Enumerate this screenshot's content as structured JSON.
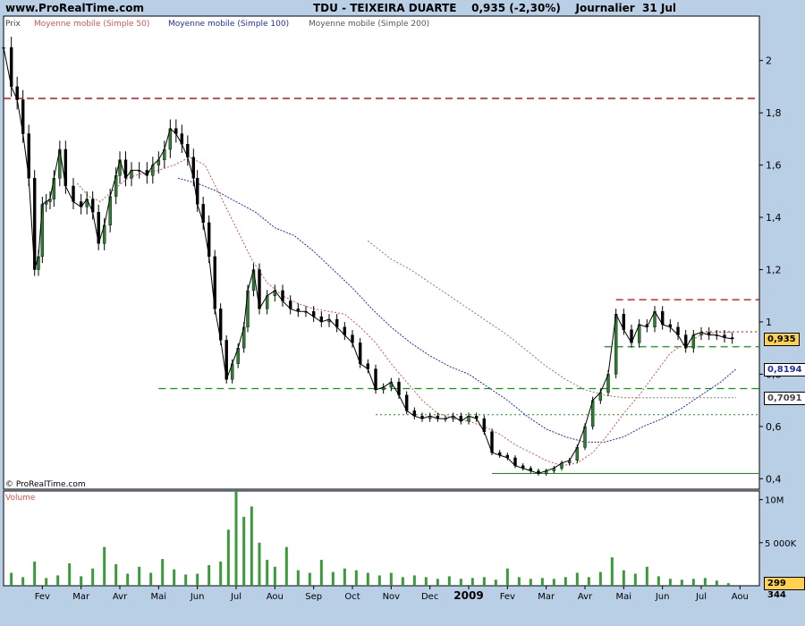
{
  "header": {
    "site": "www.ProRealTime.com",
    "title": "TDU - TEIXEIRA DUARTE    0,935 (-2,30%)    Journalier  31 Jul"
  },
  "legend": {
    "prix": "Prix",
    "ma50": "Moyenne mobile (Simple 50)",
    "ma100": "Moyenne mobile (Simple 100)",
    "ma200": "Moyenne mobile (Simple 200)",
    "copyright": "© ProRealTime.com",
    "volume": "Volume"
  },
  "colors": {
    "ma50": "#d9534f",
    "ma100": "#1f2fb8",
    "ma200": "#8c7a78",
    "candle_up": "#2e7d32",
    "candle_down": "#000000",
    "volume": "#3a9a3a",
    "hline_red": "#cc0000",
    "hline_green": "#119911"
  },
  "chart_data": {
    "type": "line",
    "price_axis": {
      "ticks": [
        "2",
        "1,8",
        "1,6",
        "1,4",
        "1,2",
        "1",
        "0,8",
        "0,6",
        "0,4"
      ],
      "ylim": [
        0.36,
        2.17
      ]
    },
    "volume_axis": {
      "ticks": [
        "10M",
        "5 000K"
      ],
      "ylim": [
        0,
        11000000
      ]
    },
    "x_labels": [
      "Fev",
      "Mar",
      "Avr",
      "Mai",
      "Jun",
      "Jul",
      "Aou",
      "Sep",
      "Oct",
      "Nov",
      "Dec",
      "2009",
      "Fev",
      "Mar",
      "Avr",
      "Mai",
      "Jun",
      "Jul",
      "Aou"
    ],
    "x_range_months": [
      0,
      19.5
    ],
    "x_label_months": [
      1,
      2,
      3,
      4,
      5,
      6,
      7,
      8,
      9,
      10,
      11,
      12,
      13,
      14,
      15,
      16,
      17,
      18,
      19
    ],
    "close": [
      [
        0.0,
        2.05
      ],
      [
        0.2,
        1.9
      ],
      [
        0.35,
        1.85
      ],
      [
        0.5,
        1.72
      ],
      [
        0.65,
        1.55
      ],
      [
        0.8,
        1.2
      ],
      [
        0.9,
        1.25
      ],
      [
        1.0,
        1.45
      ],
      [
        1.1,
        1.46
      ],
      [
        1.2,
        1.47
      ],
      [
        1.3,
        1.55
      ],
      [
        1.45,
        1.66
      ],
      [
        1.6,
        1.52
      ],
      [
        1.8,
        1.46
      ],
      [
        2.0,
        1.44
      ],
      [
        2.15,
        1.47
      ],
      [
        2.3,
        1.42
      ],
      [
        2.45,
        1.3
      ],
      [
        2.6,
        1.37
      ],
      [
        2.75,
        1.48
      ],
      [
        2.9,
        1.56
      ],
      [
        3.0,
        1.62
      ],
      [
        3.15,
        1.55
      ],
      [
        3.3,
        1.58
      ],
      [
        3.5,
        1.58
      ],
      [
        3.7,
        1.56
      ],
      [
        3.85,
        1.6
      ],
      [
        4.0,
        1.62
      ],
      [
        4.15,
        1.66
      ],
      [
        4.3,
        1.74
      ],
      [
        4.45,
        1.72
      ],
      [
        4.6,
        1.68
      ],
      [
        4.75,
        1.63
      ],
      [
        4.9,
        1.55
      ],
      [
        5.0,
        1.45
      ],
      [
        5.15,
        1.38
      ],
      [
        5.3,
        1.25
      ],
      [
        5.45,
        1.05
      ],
      [
        5.6,
        0.93
      ],
      [
        5.75,
        0.78
      ],
      [
        5.9,
        0.84
      ],
      [
        6.05,
        0.9
      ],
      [
        6.2,
        0.98
      ],
      [
        6.3,
        1.12
      ],
      [
        6.45,
        1.2
      ],
      [
        6.6,
        1.05
      ],
      [
        6.8,
        1.1
      ],
      [
        7.0,
        1.12
      ],
      [
        7.2,
        1.08
      ],
      [
        7.4,
        1.05
      ],
      [
        7.6,
        1.04
      ],
      [
        7.8,
        1.04
      ],
      [
        8.0,
        1.02
      ],
      [
        8.2,
        1.0
      ],
      [
        8.4,
        1.01
      ],
      [
        8.6,
        0.98
      ],
      [
        8.8,
        0.95
      ],
      [
        9.0,
        0.92
      ],
      [
        9.2,
        0.84
      ],
      [
        9.4,
        0.82
      ],
      [
        9.6,
        0.74
      ],
      [
        9.8,
        0.75
      ],
      [
        10.0,
        0.77
      ],
      [
        10.2,
        0.72
      ],
      [
        10.4,
        0.66
      ],
      [
        10.6,
        0.64
      ],
      [
        10.8,
        0.63
      ],
      [
        11.0,
        0.64
      ],
      [
        11.2,
        0.63
      ],
      [
        11.4,
        0.63
      ],
      [
        11.6,
        0.64
      ],
      [
        11.8,
        0.62
      ],
      [
        12.0,
        0.64
      ],
      [
        12.2,
        0.63
      ],
      [
        12.4,
        0.58
      ],
      [
        12.6,
        0.5
      ],
      [
        12.8,
        0.49
      ],
      [
        13.0,
        0.48
      ],
      [
        13.2,
        0.45
      ],
      [
        13.4,
        0.44
      ],
      [
        13.6,
        0.43
      ],
      [
        13.8,
        0.42
      ],
      [
        14.0,
        0.43
      ],
      [
        14.2,
        0.44
      ],
      [
        14.4,
        0.46
      ],
      [
        14.6,
        0.47
      ],
      [
        14.8,
        0.52
      ],
      [
        15.0,
        0.6
      ],
      [
        15.2,
        0.7
      ],
      [
        15.4,
        0.73
      ],
      [
        15.6,
        0.8
      ],
      [
        15.8,
        1.03
      ],
      [
        16.0,
        0.97
      ],
      [
        16.2,
        0.92
      ],
      [
        16.4,
        0.99
      ],
      [
        16.6,
        0.98
      ],
      [
        16.8,
        1.04
      ],
      [
        17.0,
        0.99
      ],
      [
        17.2,
        0.98
      ],
      [
        17.4,
        0.95
      ],
      [
        17.6,
        0.9
      ],
      [
        17.8,
        0.95
      ],
      [
        18.0,
        0.96
      ],
      [
        18.2,
        0.95
      ],
      [
        18.4,
        0.95
      ],
      [
        18.6,
        0.94
      ],
      [
        18.8,
        0.935
      ]
    ],
    "ma50": [
      [
        1.9,
        1.53
      ],
      [
        2.2,
        1.48
      ],
      [
        2.5,
        1.46
      ],
      [
        2.8,
        1.5
      ],
      [
        3.2,
        1.55
      ],
      [
        3.6,
        1.57
      ],
      [
        4.0,
        1.58
      ],
      [
        4.4,
        1.6
      ],
      [
        4.8,
        1.63
      ],
      [
        5.2,
        1.6
      ],
      [
        5.6,
        1.48
      ],
      [
        6.0,
        1.36
      ],
      [
        6.4,
        1.24
      ],
      [
        6.8,
        1.15
      ],
      [
        7.2,
        1.1
      ],
      [
        7.6,
        1.07
      ],
      [
        8.0,
        1.05
      ],
      [
        8.4,
        1.04
      ],
      [
        8.8,
        1.03
      ],
      [
        9.2,
        0.98
      ],
      [
        9.6,
        0.92
      ],
      [
        10.0,
        0.84
      ],
      [
        10.4,
        0.77
      ],
      [
        10.8,
        0.7
      ],
      [
        11.2,
        0.65
      ],
      [
        11.6,
        0.63
      ],
      [
        12.0,
        0.62
      ],
      [
        12.4,
        0.6
      ],
      [
        12.8,
        0.57
      ],
      [
        13.2,
        0.53
      ],
      [
        13.6,
        0.5
      ],
      [
        14.0,
        0.47
      ],
      [
        14.4,
        0.45
      ],
      [
        14.8,
        0.46
      ],
      [
        15.2,
        0.5
      ],
      [
        15.6,
        0.57
      ],
      [
        16.0,
        0.65
      ],
      [
        16.4,
        0.72
      ],
      [
        16.8,
        0.8
      ],
      [
        17.2,
        0.88
      ],
      [
        17.6,
        0.92
      ],
      [
        18.0,
        0.95
      ],
      [
        18.4,
        0.96
      ],
      [
        18.8,
        0.96
      ]
    ],
    "ma100": [
      [
        4.5,
        1.55
      ],
      [
        5.0,
        1.53
      ],
      [
        5.5,
        1.5
      ],
      [
        6.0,
        1.46
      ],
      [
        6.5,
        1.42
      ],
      [
        7.0,
        1.36
      ],
      [
        7.5,
        1.33
      ],
      [
        8.0,
        1.27
      ],
      [
        8.5,
        1.2
      ],
      [
        9.0,
        1.13
      ],
      [
        9.5,
        1.05
      ],
      [
        10.0,
        0.98
      ],
      [
        10.5,
        0.92
      ],
      [
        11.0,
        0.87
      ],
      [
        11.5,
        0.83
      ],
      [
        12.0,
        0.8
      ],
      [
        12.5,
        0.75
      ],
      [
        13.0,
        0.7
      ],
      [
        13.5,
        0.64
      ],
      [
        14.0,
        0.59
      ],
      [
        14.5,
        0.56
      ],
      [
        15.0,
        0.54
      ],
      [
        15.5,
        0.54
      ],
      [
        16.0,
        0.56
      ],
      [
        16.5,
        0.6
      ],
      [
        17.0,
        0.63
      ],
      [
        17.5,
        0.67
      ],
      [
        18.0,
        0.72
      ],
      [
        18.5,
        0.77
      ],
      [
        18.9,
        0.82
      ]
    ],
    "ma200": [
      [
        9.4,
        1.31
      ],
      [
        10.0,
        1.24
      ],
      [
        10.5,
        1.2
      ],
      [
        11.0,
        1.15
      ],
      [
        11.5,
        1.1
      ],
      [
        12.0,
        1.05
      ],
      [
        12.5,
        1.0
      ],
      [
        13.0,
        0.95
      ],
      [
        13.5,
        0.89
      ],
      [
        14.0,
        0.83
      ],
      [
        14.5,
        0.78
      ],
      [
        15.0,
        0.74
      ],
      [
        15.5,
        0.72
      ],
      [
        16.0,
        0.71
      ],
      [
        16.5,
        0.71
      ],
      [
        17.0,
        0.71
      ],
      [
        17.5,
        0.71
      ],
      [
        18.0,
        0.71
      ],
      [
        18.9,
        0.71
      ]
    ],
    "volume": [
      [
        0.2,
        1.5
      ],
      [
        0.5,
        1.0
      ],
      [
        0.8,
        2.8
      ],
      [
        1.1,
        0.9
      ],
      [
        1.4,
        1.2
      ],
      [
        1.7,
        2.6
      ],
      [
        2.0,
        1.1
      ],
      [
        2.3,
        2.0
      ],
      [
        2.6,
        4.5
      ],
      [
        2.9,
        2.5
      ],
      [
        3.2,
        1.4
      ],
      [
        3.5,
        2.2
      ],
      [
        3.8,
        1.5
      ],
      [
        4.1,
        3.1
      ],
      [
        4.4,
        1.9
      ],
      [
        4.7,
        1.3
      ],
      [
        5.0,
        1.4
      ],
      [
        5.3,
        2.4
      ],
      [
        5.6,
        2.8
      ],
      [
        5.8,
        6.5
      ],
      [
        6.0,
        11.0
      ],
      [
        6.2,
        8.0
      ],
      [
        6.4,
        9.2
      ],
      [
        6.6,
        5.0
      ],
      [
        6.8,
        3.0
      ],
      [
        7.0,
        2.2
      ],
      [
        7.3,
        4.5
      ],
      [
        7.6,
        1.8
      ],
      [
        7.9,
        1.5
      ],
      [
        8.2,
        3.0
      ],
      [
        8.5,
        1.6
      ],
      [
        8.8,
        2.0
      ],
      [
        9.1,
        1.8
      ],
      [
        9.4,
        1.5
      ],
      [
        9.7,
        1.2
      ],
      [
        10.0,
        1.5
      ],
      [
        10.3,
        1.0
      ],
      [
        10.6,
        1.2
      ],
      [
        10.9,
        1.0
      ],
      [
        11.2,
        0.8
      ],
      [
        11.5,
        1.1
      ],
      [
        11.8,
        0.8
      ],
      [
        12.1,
        0.9
      ],
      [
        12.4,
        1.0
      ],
      [
        12.7,
        0.7
      ],
      [
        13.0,
        2.0
      ],
      [
        13.3,
        1.0
      ],
      [
        13.6,
        0.8
      ],
      [
        13.9,
        0.9
      ],
      [
        14.2,
        0.8
      ],
      [
        14.5,
        1.0
      ],
      [
        14.8,
        1.5
      ],
      [
        15.1,
        1.0
      ],
      [
        15.4,
        1.6
      ],
      [
        15.7,
        3.3
      ],
      [
        16.0,
        1.8
      ],
      [
        16.3,
        1.4
      ],
      [
        16.6,
        2.2
      ],
      [
        16.9,
        1.1
      ],
      [
        17.2,
        0.8
      ],
      [
        17.5,
        0.7
      ],
      [
        17.8,
        0.8
      ],
      [
        18.1,
        0.9
      ],
      [
        18.4,
        0.6
      ],
      [
        18.7,
        0.3
      ]
    ],
    "hlines": [
      {
        "y": 1.855,
        "x0": 0,
        "x1": 19.5,
        "style": "red-dash"
      },
      {
        "y": 1.085,
        "x0": 15.8,
        "x1": 19.5,
        "style": "red-dash"
      },
      {
        "y": 0.962,
        "x0": 18.0,
        "x1": 19.5,
        "style": "red-dot"
      },
      {
        "y": 0.905,
        "x0": 15.5,
        "x1": 19.5,
        "style": "green-dash"
      },
      {
        "y": 0.745,
        "x0": 4.0,
        "x1": 19.5,
        "style": "green-dash"
      },
      {
        "y": 0.645,
        "x0": 9.6,
        "x1": 19.5,
        "style": "green-dot"
      },
      {
        "y": 0.42,
        "x0": 12.6,
        "x1": 19.5,
        "style": "green-solid"
      }
    ],
    "value_tags": [
      {
        "label": "0,935",
        "y": 0.935,
        "bg": "#ffd24d",
        "fg": "#000000"
      },
      {
        "label": "0,8194",
        "y": 0.8194,
        "bg": "#ffffff",
        "fg": "#1f2fb8"
      },
      {
        "label": "0,7091",
        "y": 0.7091,
        "bg": "#ffffff",
        "fg": "#444444"
      },
      {
        "label": "299 344",
        "y": 299344,
        "bg": "#ffd24d",
        "fg": "#000000",
        "panel": "volume"
      }
    ]
  }
}
